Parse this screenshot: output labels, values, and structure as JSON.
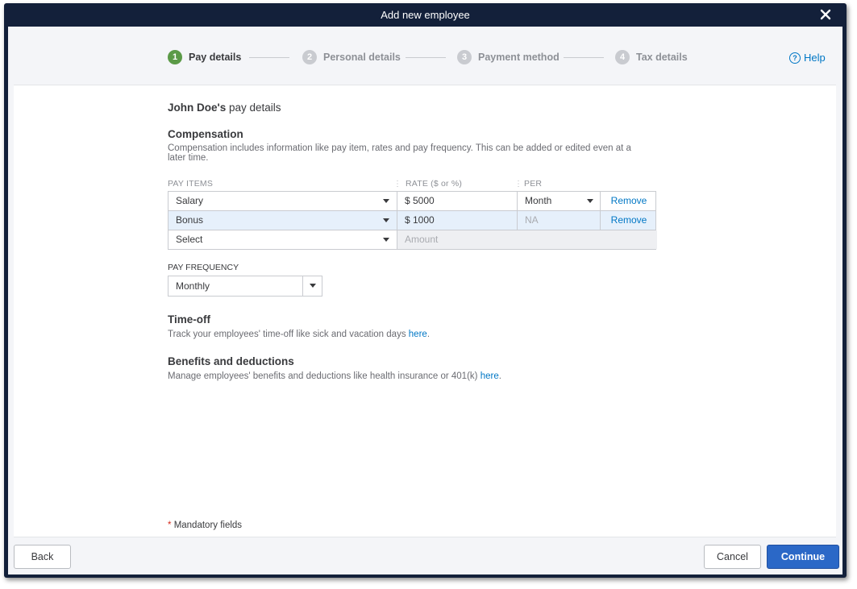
{
  "window": {
    "title": "Add new employee"
  },
  "stepper": {
    "steps": [
      {
        "number": "1",
        "label": "Pay details",
        "active": true
      },
      {
        "number": "2",
        "label": "Personal details",
        "active": false
      },
      {
        "number": "3",
        "label": "Payment method",
        "active": false
      },
      {
        "number": "4",
        "label": "Tax details",
        "active": false
      }
    ],
    "help_label": "Help"
  },
  "page": {
    "employee_name": "John Doe's",
    "title_suffix": "pay details"
  },
  "compensation": {
    "heading": "Compensation",
    "description": "Compensation includes information like pay item, rates and pay frequency. This can be added or edited even at a later time.",
    "columns": {
      "pay_items": "PAY ITEMS",
      "rate": "RATE ($ or %)",
      "per": "PER"
    },
    "rows": [
      {
        "item": "Salary",
        "rate": "$ 5000",
        "per": "Month",
        "action": "Remove"
      },
      {
        "item": "Bonus",
        "rate": "$ 1000",
        "per": "NA",
        "action": "Remove"
      }
    ],
    "new_row": {
      "item_placeholder": "Select",
      "amount_placeholder": "Amount"
    }
  },
  "pay_frequency": {
    "label": "PAY FREQUENCY",
    "value": "Monthly"
  },
  "time_off": {
    "heading": "Time-off",
    "text": "Track your employees' time-off like sick and vacation days",
    "link": "here"
  },
  "benefits": {
    "heading": "Benefits and deductions",
    "text": "Manage employees' benefits and deductions like health insurance or 401(k)",
    "link": "here"
  },
  "mandatory": {
    "star": "*",
    "text": "Mandatory fields"
  },
  "footer": {
    "back_label": "Back",
    "cancel_label": "Cancel",
    "continue_label": "Continue"
  },
  "colors": {
    "accent": "#2b68c7",
    "link": "#0077c5",
    "step_active": "#5b9a47",
    "titlebar": "#13203a"
  }
}
